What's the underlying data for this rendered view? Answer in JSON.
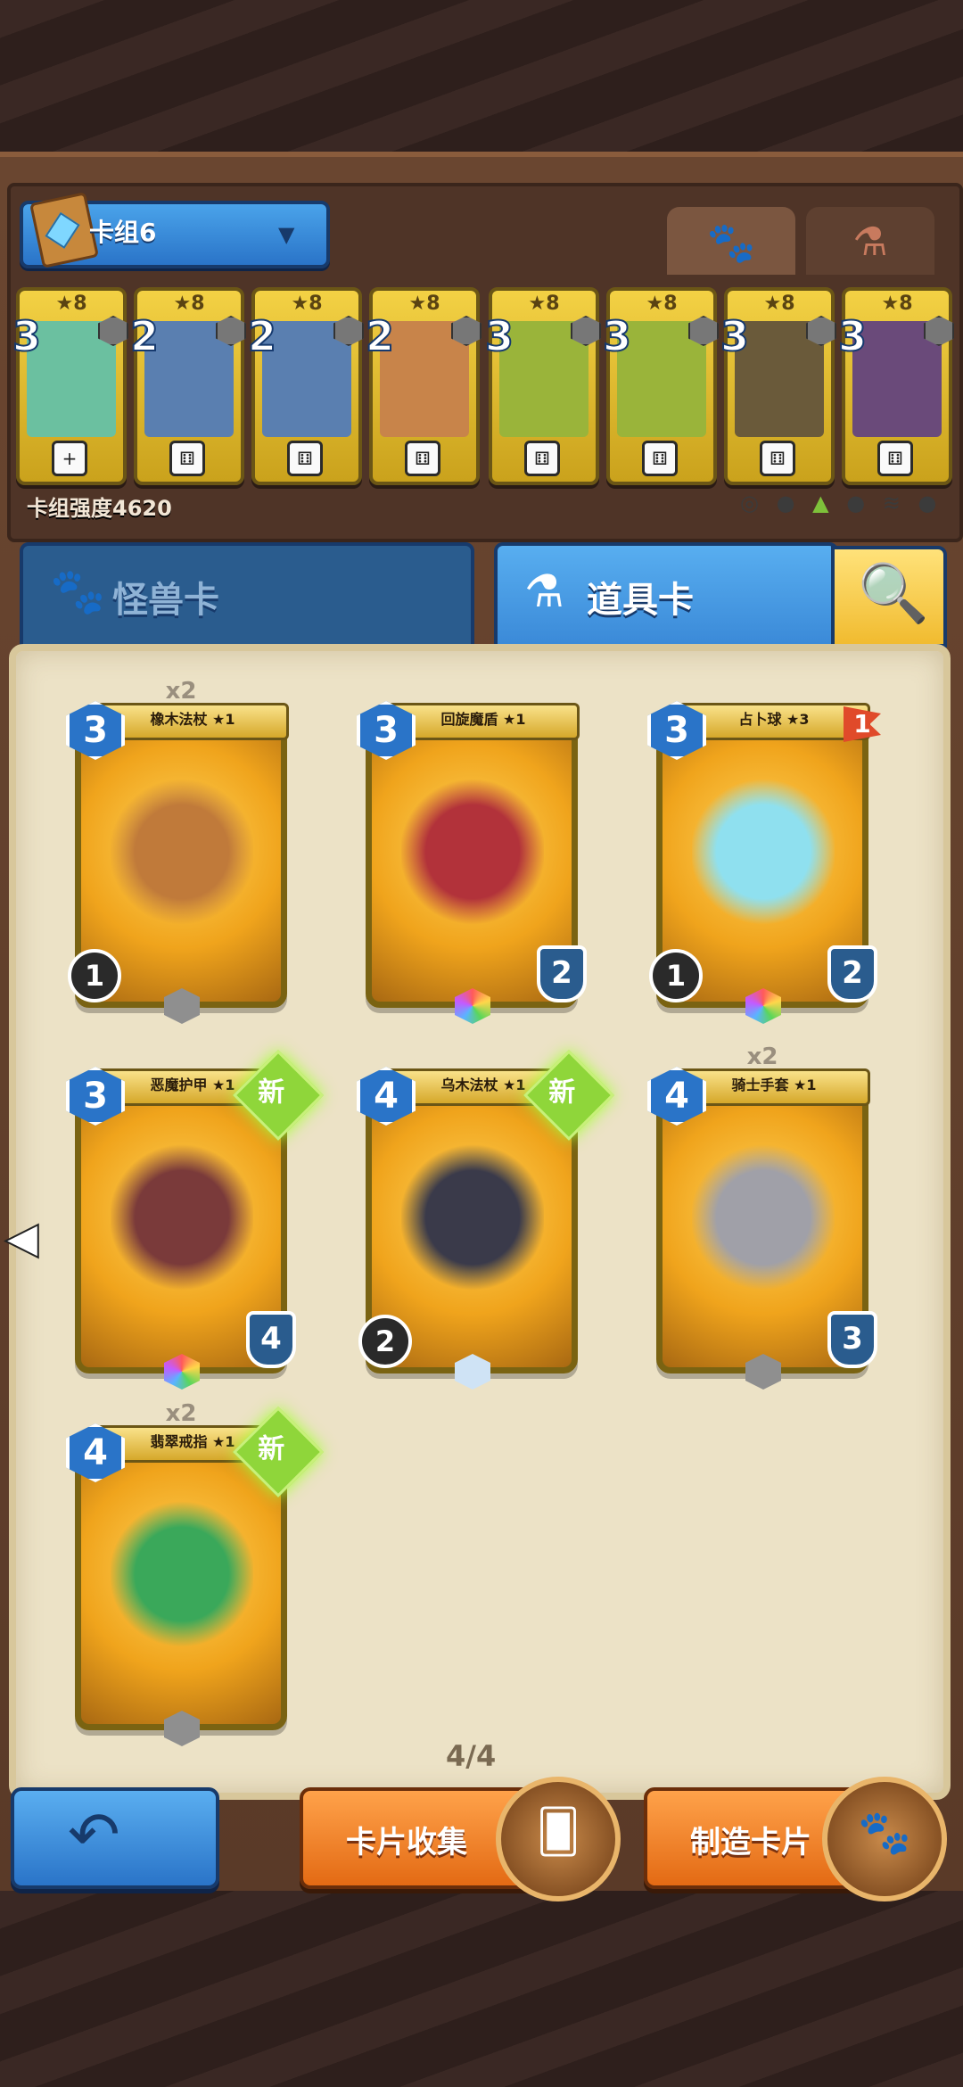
{
  "deck": {
    "name": "卡组6",
    "strength_label": "卡组强度4620"
  },
  "deck_cards": [
    {
      "level": "★8",
      "cost": "3",
      "die": "+",
      "art": "#6bc0a0"
    },
    {
      "level": "★8",
      "cost": "2",
      "die": "⚅",
      "art": "#5a7fb0"
    },
    {
      "level": "★8",
      "cost": "2",
      "die": "⚅",
      "art": "#5a7fb0"
    },
    {
      "level": "★8",
      "cost": "2",
      "die": "⚅",
      "art": "#c8844a"
    },
    {
      "level": "★8",
      "cost": "3",
      "die": "⚅",
      "art": "#9ab43a"
    },
    {
      "level": "★8",
      "cost": "3",
      "die": "⚅",
      "art": "#9ab43a"
    },
    {
      "level": "★8",
      "cost": "3",
      "die": "⚅",
      "art": "#6a5a3a"
    },
    {
      "level": "★8",
      "cost": "3",
      "die": "⚅",
      "art": "#6a4a7a"
    }
  ],
  "tabs": {
    "monster": "怪兽卡",
    "item": "道具卡"
  },
  "items": [
    {
      "name": "橡木法杖 ★1",
      "cost": "3",
      "count": "x2",
      "uses": "1",
      "armor": "",
      "flag": "",
      "new": "",
      "gem": "gray",
      "art": "#c07a3a"
    },
    {
      "name": "回旋魔盾 ★1",
      "cost": "3",
      "count": "",
      "uses": "",
      "armor": "2",
      "flag": "",
      "new": "",
      "gem": "rainbow",
      "art": "#b2323a"
    },
    {
      "name": "占卜球 ★3",
      "cost": "3",
      "count": "",
      "uses": "1",
      "armor": "2",
      "flag": "1",
      "new": "",
      "gem": "rainbow",
      "art": "#8fe0ef"
    },
    {
      "name": "恶魔护甲 ★1",
      "cost": "3",
      "count": "",
      "uses": "",
      "armor": "4",
      "flag": "",
      "new": "新",
      "gem": "rainbow",
      "art": "#7a3a3a"
    },
    {
      "name": "乌木法杖 ★1",
      "cost": "4",
      "count": "",
      "uses": "2",
      "armor": "",
      "flag": "",
      "new": "新",
      "gem": "white",
      "art": "#3a3a4a"
    },
    {
      "name": "骑士手套 ★1",
      "cost": "4",
      "count": "x2",
      "uses": "",
      "armor": "3",
      "flag": "",
      "new": "",
      "gem": "gray",
      "art": "#a0a0a8"
    },
    {
      "name": "翡翠戒指 ★1",
      "cost": "4",
      "count": "x2",
      "uses": "",
      "armor": "",
      "flag": "",
      "new": "新",
      "gem": "gray",
      "art": "#3aa85a"
    }
  ],
  "page_count": "4/4",
  "buttons": {
    "back": "↶",
    "collect": "卡片收集",
    "craft": "制造卡片"
  },
  "icons": {
    "monster_tab": "paw-icon",
    "item_tab": "potion-icon",
    "search": "magnifier-icon"
  }
}
